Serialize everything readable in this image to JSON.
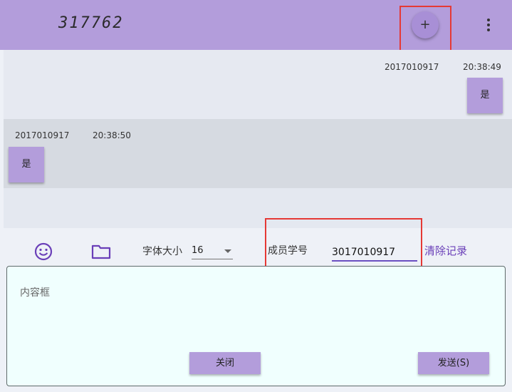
{
  "header": {
    "title": "317762",
    "add_label": "+"
  },
  "messages": [
    {
      "sender": "2017010917",
      "time": "20:38:49",
      "text": "是",
      "side": "right"
    },
    {
      "sender": "2017010917",
      "time": "20:38:50",
      "text": "是",
      "side": "left"
    }
  ],
  "toolbar": {
    "font_size_label": "字体大小",
    "font_size_value": "16",
    "member_id_label": "成员学号",
    "member_id_value": "3017010917",
    "clear_label": "清除记录"
  },
  "content": {
    "placeholder": "内容框",
    "close_label": "关闭",
    "send_label": "发送(S)"
  },
  "colors": {
    "primary": "#b39ddb",
    "accent": "#6a3fb8",
    "highlight": "#e53935"
  }
}
